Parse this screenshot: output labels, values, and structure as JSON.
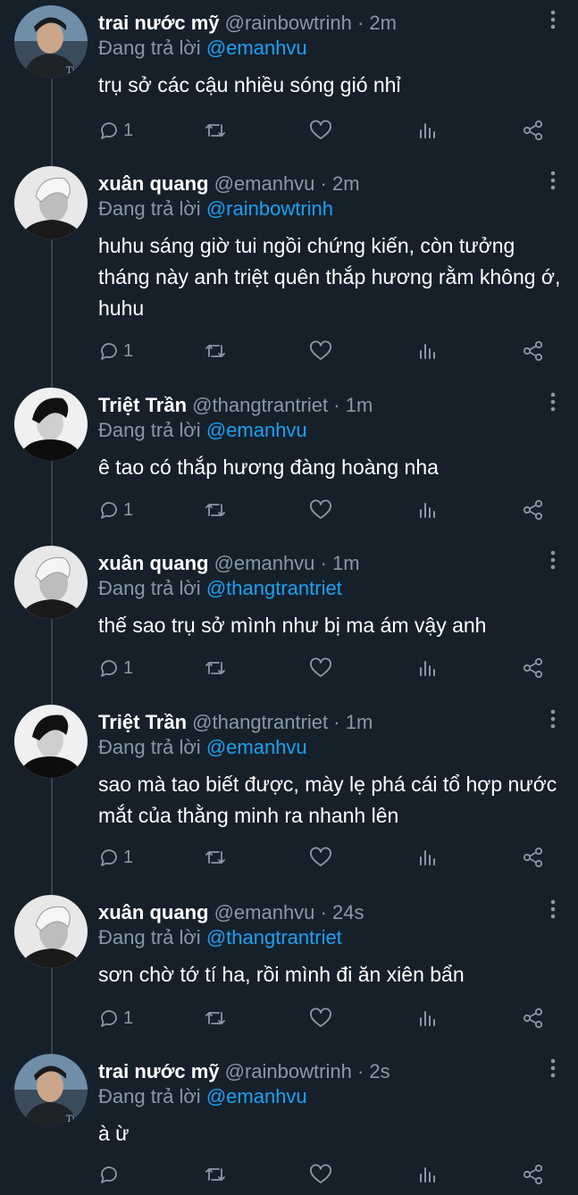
{
  "replying_prefix": "Đang trả lời",
  "tweets": [
    {
      "name": "trai nước mỹ",
      "handle": "@rainbowtrinh",
      "time": "· 2m",
      "reply_to": "@emanhvu",
      "text": "trụ sở các cậu nhiều sóng gió nhỉ",
      "reply_count": "1",
      "avatar": "avatar-trinh"
    },
    {
      "name": "xuân quang",
      "handle": "@emanhvu",
      "time": "· 2m",
      "reply_to": "@rainbowtrinh",
      "text": "huhu sáng giờ tui ngồi chứng kiến, còn tưởng tháng này anh triệt quên thắp hương rằm không ớ, huhu",
      "reply_count": "1",
      "avatar": "avatar-quang"
    },
    {
      "name": "Triệt Trần",
      "handle": "@thangtrantriet",
      "time": "· 1m",
      "reply_to": "@emanhvu",
      "text": "ê tao có thắp hương đàng hoàng nha",
      "reply_count": "1",
      "avatar": "avatar-triet"
    },
    {
      "name": "xuân quang",
      "handle": "@emanhvu",
      "time": "· 1m",
      "reply_to": "@thangtrantriet",
      "text": "thế sao trụ sở mình như bị ma ám vậy anh",
      "reply_count": "1",
      "avatar": "avatar-quang"
    },
    {
      "name": "Triệt Trần",
      "handle": "@thangtrantriet",
      "time": "· 1m",
      "reply_to": "@emanhvu",
      "text": "sao mà tao biết được, mày lẹ phá cái tổ hợp nước mắt của thằng minh ra nhanh lên",
      "reply_count": "1",
      "avatar": "avatar-triet"
    },
    {
      "name": "xuân quang",
      "handle": "@emanhvu",
      "time": "· 24s",
      "reply_to": "@thangtrantriet",
      "text": "sơn chờ tớ tí ha, rồi mình đi ăn xiên bẩn",
      "reply_count": "1",
      "avatar": "avatar-quang"
    },
    {
      "name": "trai nước mỹ",
      "handle": "@rainbowtrinh",
      "time": "· 2s",
      "reply_to": "@emanhvu",
      "text": "à ừ",
      "reply_count": "",
      "avatar": "avatar-trinh"
    }
  ],
  "colors": {
    "background": "#15202b",
    "muted": "#8899a6",
    "mention": "#1da1f2",
    "text": "#ffffff",
    "thread_line": "#38444d"
  },
  "icons": [
    "reply-icon",
    "retweet-icon",
    "like-icon",
    "analytics-icon",
    "share-icon",
    "more-options-icon"
  ]
}
